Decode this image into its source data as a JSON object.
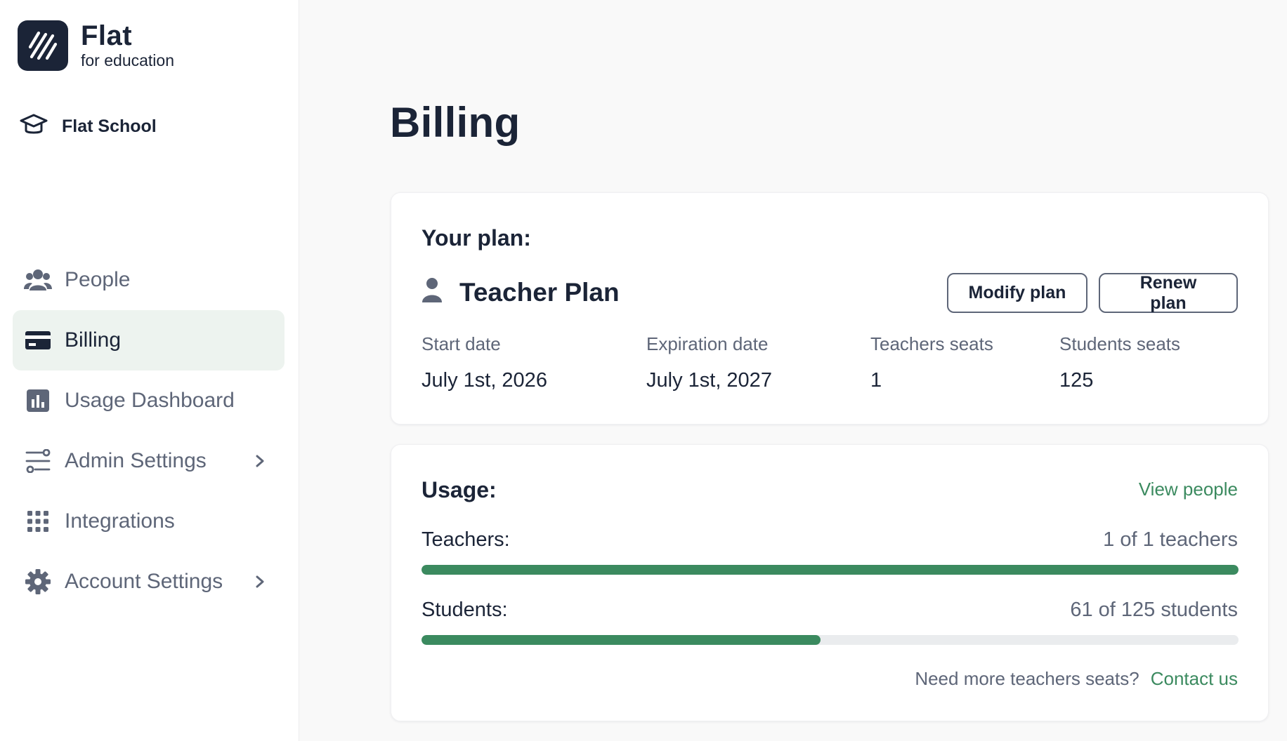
{
  "brand": {
    "name": "Flat",
    "subtitle": "for education"
  },
  "school": {
    "name": "Flat School"
  },
  "sidebar": {
    "items": [
      {
        "label": "People",
        "icon": "people-icon",
        "active": false
      },
      {
        "label": "Billing",
        "icon": "credit-card-icon",
        "active": true
      },
      {
        "label": "Usage Dashboard",
        "icon": "bar-chart-icon",
        "active": false
      },
      {
        "label": "Admin Settings",
        "icon": "sliders-icon",
        "active": false,
        "has_submenu": true
      },
      {
        "label": "Integrations",
        "icon": "grid-icon",
        "active": false
      },
      {
        "label": "Account Settings",
        "icon": "gear-icon",
        "active": false,
        "has_submenu": true
      }
    ]
  },
  "page": {
    "title": "Billing"
  },
  "plan": {
    "section_title": "Your plan:",
    "name": "Teacher Plan",
    "modify_label": "Modify plan",
    "renew_label": "Renew plan",
    "fields": [
      {
        "label": "Start date",
        "value": "July 1st, 2026"
      },
      {
        "label": "Expiration date",
        "value": "July 1st, 2027"
      },
      {
        "label": "Teachers seats",
        "value": "1"
      },
      {
        "label": "Students seats",
        "value": "125"
      }
    ]
  },
  "usage": {
    "section_title": "Usage:",
    "view_people_label": "View people",
    "teachers": {
      "label": "Teachers:",
      "count_text": "1 of 1 teachers",
      "used": 1,
      "total": 1
    },
    "students": {
      "label": "Students:",
      "count_text": "61 of 125 students",
      "used": 61,
      "total": 125
    },
    "footer_question": "Need more teachers seats?",
    "contact_label": "Contact us"
  },
  "colors": {
    "accent_green": "#3b8a5f",
    "navy": "#1b2437",
    "muted_text": "#5e6678",
    "active_nav_bg": "#edf3ef"
  }
}
